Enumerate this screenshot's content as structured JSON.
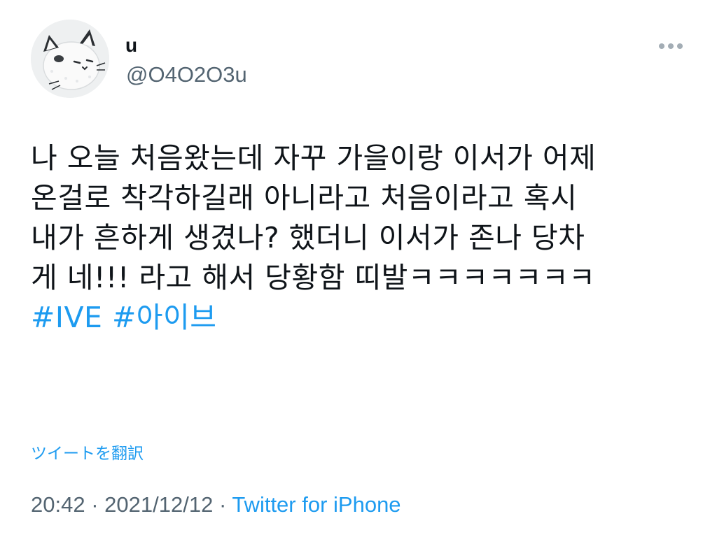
{
  "author": {
    "name": "u",
    "handle": "@O4O2O3u"
  },
  "tweet": {
    "lines": [
      "나 오늘 처음왔는데 자꾸 가을이랑 이서가 어제",
      "온걸로 착각하길래 아니라고 처음이라고 혹시",
      "내가 흔하게 생겼나? 했더니 이서가 존나 당차",
      "게 네!!! 라고 해서 당황함 띠발ㅋㅋㅋㅋㅋㅋㅋ"
    ],
    "hashtags": [
      "#IVE",
      "#아이브"
    ]
  },
  "translate_label": "ツイートを翻訳",
  "meta": {
    "time": "20:42",
    "separator": "·",
    "date": "2021/12/12",
    "source": "Twitter for iPhone"
  },
  "icons": {
    "more": "more-horizontal-icon",
    "avatar": "cat-avatar"
  },
  "colors": {
    "link": "#1d9bf0",
    "secondary_text": "#536471",
    "primary_text": "#0f1419"
  }
}
